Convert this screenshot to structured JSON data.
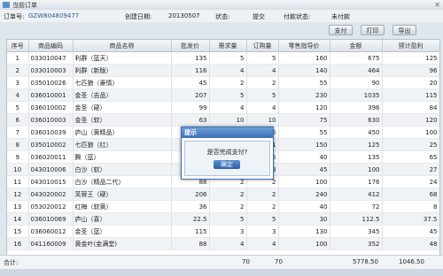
{
  "window": {
    "title": "当前订单",
    "close": "✕"
  },
  "info": {
    "order_label": "订单号:",
    "order_value": "GZW804809477",
    "date_label": "创建日期:",
    "date_value": "20130507",
    "status_label": "状态:",
    "status_value": "提交",
    "pay_label": "付款状态:",
    "pay_value": "未付款"
  },
  "toolbar": {
    "pay": "支付",
    "print": "打印",
    "export": "导出"
  },
  "columns": [
    "序号",
    "商品编码",
    "商品名称",
    "批发价",
    "需求量",
    "订购量",
    "零售指导价",
    "金额",
    "预计盈利"
  ],
  "rows": [
    [
      "1",
      "033010047",
      "利群（蓝天）",
      "135",
      "5",
      "5",
      "160",
      "675",
      "125"
    ],
    [
      "2",
      "033010003",
      "利群（新版）",
      "116",
      "4",
      "4",
      "140",
      "464",
      "96"
    ],
    [
      "3",
      "035010026",
      "七匹狼（豪情）",
      "45",
      "2",
      "2",
      "55",
      "90",
      "20"
    ],
    [
      "4",
      "036010001",
      "金圣（吉品）",
      "207",
      "5",
      "5",
      "230",
      "1035",
      "115"
    ],
    [
      "5",
      "036010002",
      "金圣（硬）",
      "99",
      "4",
      "4",
      "120",
      "396",
      "84"
    ],
    [
      "6",
      "036010003",
      "金圣（软）",
      "63",
      "10",
      "10",
      "75",
      "630",
      "120"
    ],
    [
      "7",
      "036010039",
      "庐山（黄精品）",
      "",
      "",
      "5",
      "55",
      "450",
      "100"
    ],
    [
      "8",
      "035010002",
      "七匹狼（红）",
      "",
      "",
      "1",
      "150",
      "125",
      "25"
    ],
    [
      "9",
      "036020011",
      "腾（蓝）",
      "",
      "",
      "5",
      "40",
      "135",
      "65"
    ],
    [
      "10",
      "043010006",
      "白沙（软）",
      "",
      "",
      "3",
      "45",
      "100",
      "27"
    ],
    [
      "11",
      "043010015",
      "白沙（精品二代）",
      "88",
      "2",
      "2",
      "100",
      "176",
      "24"
    ],
    [
      "12",
      "043020002",
      "芙蓉王（硬）",
      "206",
      "2",
      "2",
      "240",
      "412",
      "68"
    ],
    [
      "13",
      "053020012",
      "红梅（软黄）",
      "36",
      "2",
      "2",
      "40",
      "72",
      "8"
    ],
    [
      "14",
      "036010069",
      "庐山（喜）",
      "22.5",
      "5",
      "5",
      "30",
      "112.5",
      "37.5"
    ],
    [
      "15",
      "036060012",
      "金圣（蓝）",
      "115",
      "3",
      "3",
      "130",
      "345",
      "45"
    ],
    [
      "16",
      "041160009",
      "黄金叶(金满堂)",
      "88",
      "4",
      "4",
      "100",
      "352",
      "48"
    ]
  ],
  "footer": {
    "label": "合计:",
    "demand_total": "70",
    "order_total": "70",
    "amount_total": "5778.50",
    "profit_total": "1046.50"
  },
  "dialog": {
    "title": "提示",
    "message": "是否完成支付?",
    "ok": "确定"
  }
}
